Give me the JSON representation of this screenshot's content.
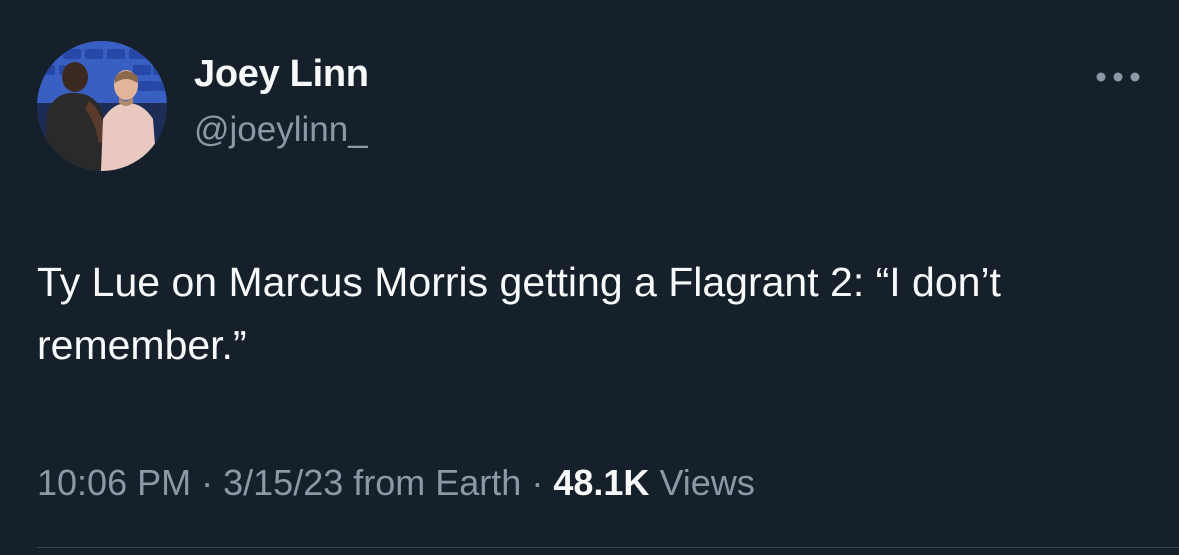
{
  "author": {
    "display_name": "Joey Linn",
    "handle": "@joeylinn_"
  },
  "tweet": {
    "text": "Ty Lue on Marcus Morris getting a Flagrant 2: “I don’t remember.”"
  },
  "meta": {
    "time": "10:06 PM",
    "separator": "·",
    "date": "3/15/23",
    "source": "from Earth",
    "views_count": "48.1K",
    "views_label": "Views"
  },
  "icons": {
    "more": "more-horizontal-icon",
    "avatar": "profile-photo"
  },
  "colors": {
    "background": "#15202b",
    "primary_text": "#f7f9f9",
    "secondary_text": "#8b98a5",
    "divider": "#38444d"
  }
}
